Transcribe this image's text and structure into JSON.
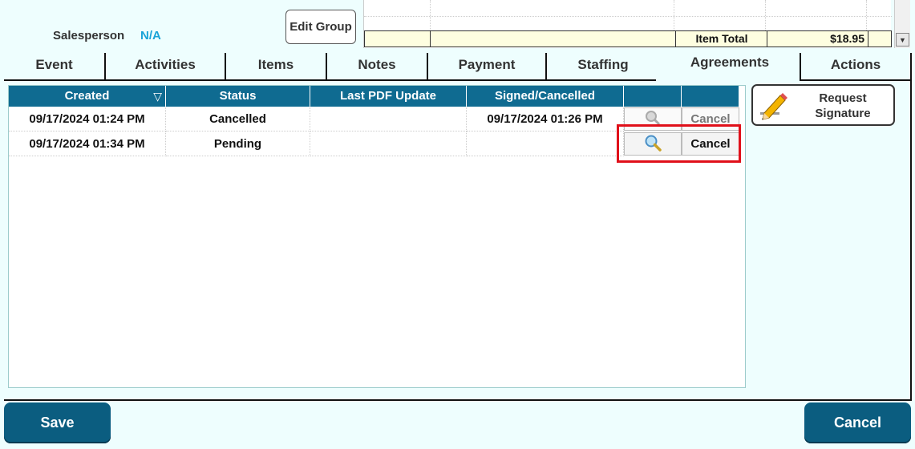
{
  "header": {
    "salesperson_label": "Salesperson",
    "salesperson_value": "N/A",
    "edit_group_label": "Edit Group",
    "item_total_label": "Item Total",
    "item_total_value": "$18.95"
  },
  "tabs": [
    {
      "label": "Event"
    },
    {
      "label": "Activities"
    },
    {
      "label": "Items"
    },
    {
      "label": "Notes"
    },
    {
      "label": "Payment"
    },
    {
      "label": "Staffing"
    },
    {
      "label": "Agreements",
      "active": true
    },
    {
      "label": "Actions"
    }
  ],
  "agreements": {
    "columns": [
      "Created",
      "Status",
      "Last PDF Update",
      "Signed/Cancelled",
      "",
      ""
    ],
    "sort_indicator": "▽",
    "rows": [
      {
        "created": "09/17/2024 01:24 PM",
        "status": "Cancelled",
        "last_pdf_update": "",
        "signed_cancelled": "09/17/2024 01:26 PM",
        "view_enabled": false,
        "cancel_label": "Cancel",
        "cancel_enabled": false
      },
      {
        "created": "09/17/2024 01:34 PM",
        "status": "Pending",
        "last_pdf_update": "",
        "signed_cancelled": "",
        "view_enabled": true,
        "cancel_label": "Cancel",
        "cancel_enabled": true
      }
    ]
  },
  "side": {
    "request_signature_label": "Request\nSignature",
    "icon": "pencil-icon"
  },
  "footer": {
    "save_label": "Save",
    "cancel_label": "Cancel"
  },
  "colors": {
    "background": "#eefefe",
    "header": "#0f6b91",
    "button": "#0b5d80",
    "accent_text": "#1aa3d8",
    "highlight": "#e0101a"
  }
}
